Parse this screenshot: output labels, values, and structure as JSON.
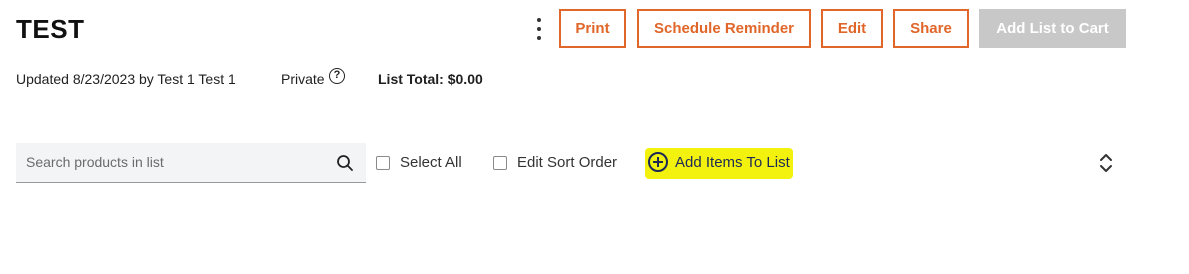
{
  "header": {
    "title": "TEST",
    "more_icon": "vertical-ellipsis-icon",
    "buttons": {
      "print": "Print",
      "schedule_reminder": "Schedule Reminder",
      "edit": "Edit",
      "share": "Share",
      "add_to_cart": "Add List to Cart"
    }
  },
  "meta": {
    "updated": "Updated 8/23/2023 by Test 1 Test 1",
    "visibility": "Private",
    "help_icon": "question-circle-icon",
    "list_total": "List Total: $0.00"
  },
  "toolbar": {
    "search_placeholder": "Search products in list",
    "search_icon": "search-icon",
    "select_all": "Select All",
    "edit_sort_order": "Edit Sort Order",
    "add_items": "Add Items To List",
    "add_icon": "plus-circle-icon",
    "sort_icon": "sort-toggle-icon"
  },
  "colors": {
    "accent": "#e0662a",
    "disabled_button": "#c8c8c8",
    "highlight": "#f2f20e",
    "link_navy": "#1d2a55"
  }
}
